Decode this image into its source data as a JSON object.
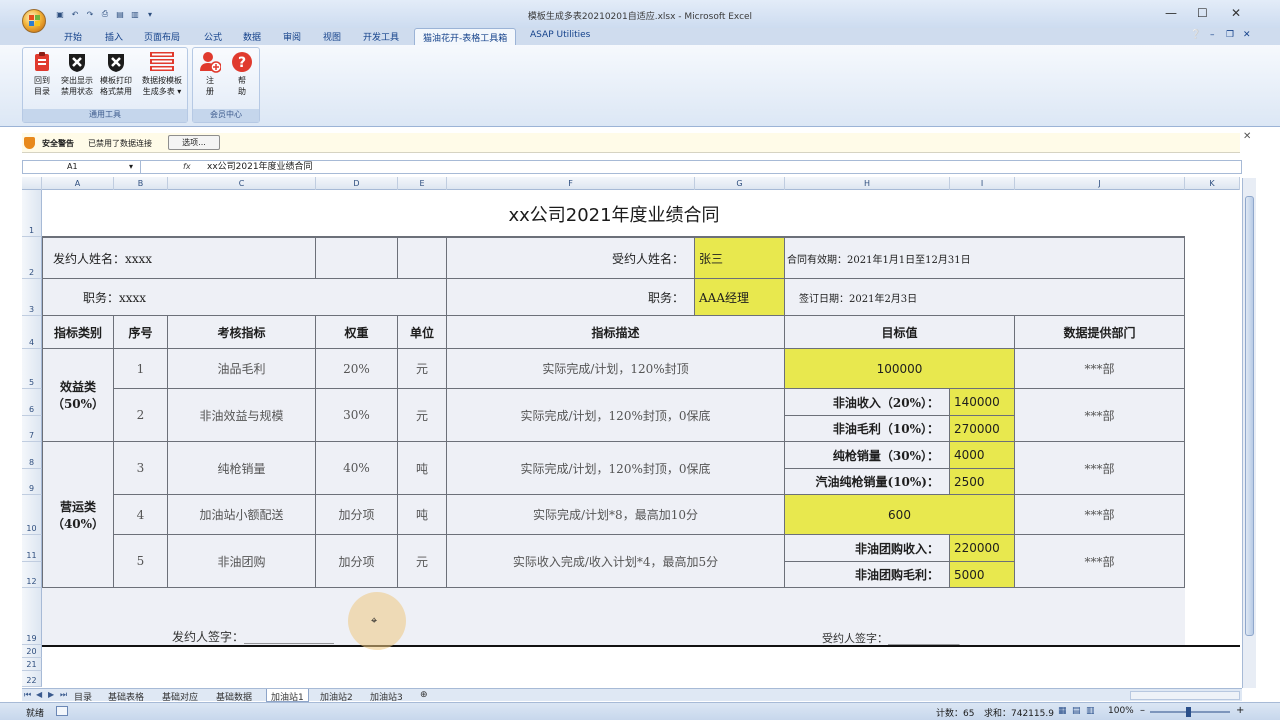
{
  "window": {
    "title": "模板生成多表20210201自适应.xlsx - Microsoft Excel",
    "minimize": "—",
    "maximize": "☐",
    "close": "✕"
  },
  "tabs": [
    "开始",
    "插入",
    "页面布局",
    "公式",
    "数据",
    "审阅",
    "视图",
    "开发工具",
    "猫油花开-表格工具箱",
    "ASAP Utilities"
  ],
  "ribbon": {
    "group_general_label": "通用工具",
    "group_member_label": "会员中心",
    "buttons": {
      "back": "回到\n目录",
      "highlight": "突出显示\n禁用状态",
      "print_format": "模板打印\n格式禁用",
      "generate": "数据按模板\n生成多表 ▾",
      "register": "注\n册",
      "help": "帮\n助"
    }
  },
  "security": {
    "label": "安全警告",
    "message": "已禁用了数据连接",
    "options": "选项..."
  },
  "formula_bar": {
    "cell_ref": "A1",
    "fx": "fx",
    "content": "xx公司2021年度业绩合同"
  },
  "columns": [
    "A",
    "B",
    "C",
    "D",
    "E",
    "F",
    "G",
    "H",
    "I",
    "J",
    "K"
  ],
  "rows": [
    "1",
    "2",
    "3",
    "4",
    "5",
    "6",
    "7",
    "8",
    "9",
    "10",
    "11",
    "12",
    "19",
    "20",
    "21",
    "22"
  ],
  "contract": {
    "title": "xx公司2021年度业绩合同",
    "issuer_name_label": "发约人姓名：xxxx",
    "issuer_post_label": "职务：xxxx",
    "receiver_name_label": "受约人姓名：",
    "receiver_name": "张三",
    "receiver_post_label": "职务：",
    "receiver_post": "AAA经理",
    "valid_period": "合同有效期：2021年1月1日至12月31日",
    "sign_date": "签订日期：2021年2月3日",
    "headers": [
      "指标类别",
      "序号",
      "考核指标",
      "权重",
      "单位",
      "指标描述",
      "目标值",
      "数据提供部门"
    ],
    "category_efficiency": "效益类\n（50%）",
    "category_operation": "营运类\n（40%）",
    "rows": [
      {
        "no": "1",
        "metric": "油品毛利",
        "weight": "20%",
        "unit": "元",
        "desc": "实际完成/计划，120%封顶",
        "dept": "***部"
      },
      {
        "no": "2",
        "metric": "非油效益与规模",
        "weight": "30%",
        "unit": "元",
        "desc": "实际完成/计划，120%封顶，0保底",
        "dept": "***部"
      },
      {
        "no": "3",
        "metric": "纯枪销量",
        "weight": "40%",
        "unit": "吨",
        "desc": "实际完成/计划，120%封顶，0保底",
        "dept": "***部"
      },
      {
        "no": "4",
        "metric": "加油站小额配送",
        "weight": "加分项",
        "unit": "吨",
        "desc": "实际完成/计划*8，最高加10分",
        "dept": "***部"
      },
      {
        "no": "5",
        "metric": "非油团购",
        "weight": "加分项",
        "unit": "元",
        "desc": "实际收入完成/收入计划*4，最高加5分",
        "dept": "***部"
      }
    ],
    "targets": {
      "t1": "100000",
      "t2a_label": "非油收入（20%）：",
      "t2a_value": "140000",
      "t2b_label": "非油毛利（10%）：",
      "t2b_value": "270000",
      "t3a_label": "纯枪销量（30%）：",
      "t3a_value": "4000",
      "t3b_label": "汽油纯枪销量(10%)：",
      "t3b_value": "2500",
      "t4": "600",
      "t5a_label": "非油团购收入：",
      "t5a_value": "220000",
      "t5b_label": "非油团购毛利：",
      "t5b_value": "5000"
    },
    "issuer_sign": "发约人签字：_______________",
    "receiver_sign": "受约人签字：_____________"
  },
  "sheet_tabs": [
    "目录",
    "基础表格",
    "基础对应",
    "基础数据",
    "加油站1",
    "加油站2",
    "加油站3"
  ],
  "status": {
    "ready": "就绪",
    "count": "计数：65",
    "sum": "求和：742115.9",
    "zoom": "100%"
  }
}
